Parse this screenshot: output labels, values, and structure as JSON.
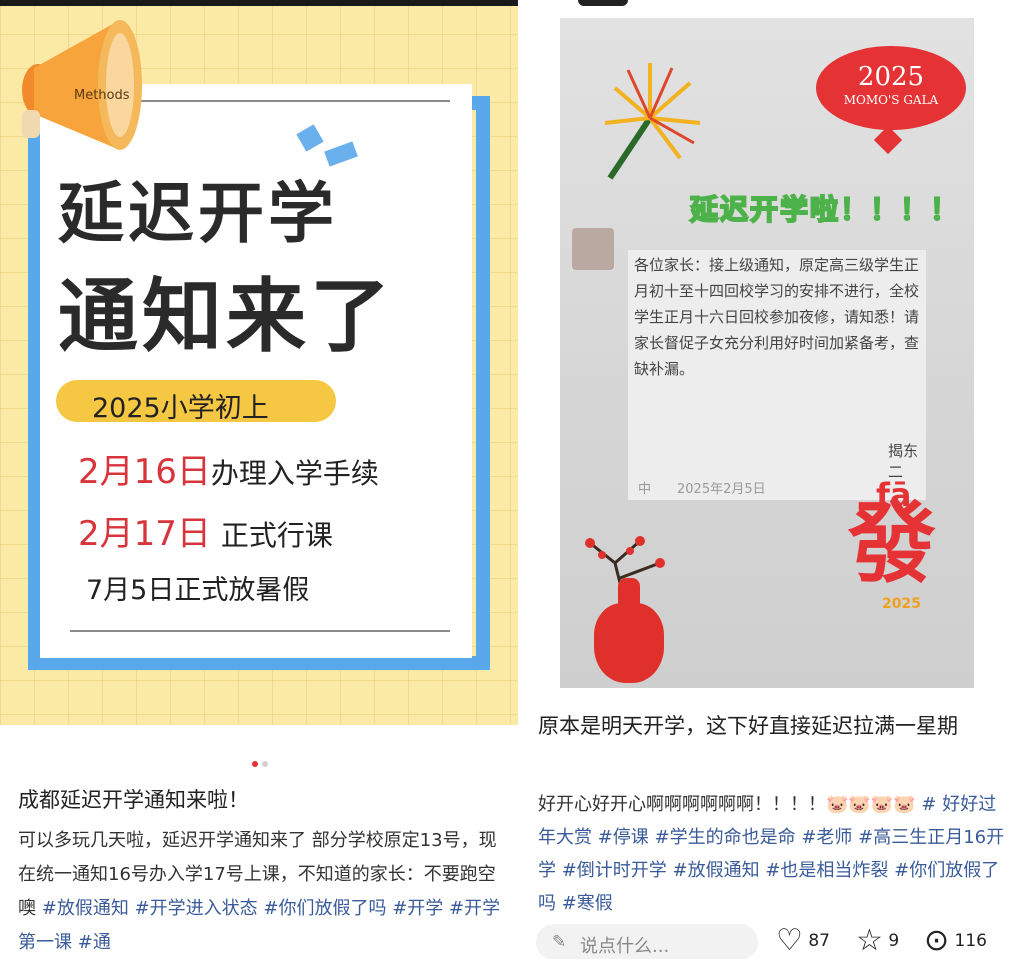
{
  "left_post": {
    "poster": {
      "megaphone_label": "Methods",
      "headline_line1": "延迟开学",
      "headline_line2": "通知来了",
      "pill_text": "2025小学初上",
      "date1": "2月16日",
      "date1_text": "办理入学手续",
      "date2": "2月17日",
      "date2_text": "正式行课",
      "line3": "7月5日正式放暑假"
    },
    "title": "成都延迟开学通知来啦！",
    "desc_plain": "可以多玩几天啦，延迟开学通知来了 部分学校原定13号，现在统一通知16号办入学17号上课，不知道的家长：不要跑空噢",
    "tags": [
      "#放假通知",
      "#开学进入状态",
      "#你们放假了吗",
      "#开学",
      "#开学第一课",
      "#通"
    ]
  },
  "right_post": {
    "photo": {
      "gala_year": "2025",
      "gala_name": "MOMO'S GALA",
      "banner": "延迟开学啦！！！！",
      "notice_text": "各位家长：接上级通知，原定高三级学生正月初十至十四回校学习的安排不进行，全校学生正月十六日回校参加夜修，请知悉！请家长督促子女充分利用好时间加紧备考，查缺补漏。",
      "signature": "揭东二",
      "date_line": "中　　2025年2月5日",
      "fa_pinyin": "fā",
      "fa_char": "發",
      "fa_year": "2025"
    },
    "caption": "原本是明天开学，这下好直接延迟拉满一星期",
    "text_prefix": "好开心好开心啊啊啊啊啊啊！！！！",
    "emoji": "🐷🐷🐷🐷",
    "tags_line": "# 好好过年大赏 #停课 #学生的命也是命 #老师 #高三生正月16开学 #倒计时开学 #放假通知 #也是相当炸裂 #你们放假了吗 #寒假",
    "comment_placeholder": "说点什么...",
    "likes": "87",
    "stars": "9",
    "comments": "116"
  },
  "colors": {
    "poster_yellow": "#fbe9a6",
    "poster_blue": "#59a8ec",
    "accent_red": "#d8343b",
    "tag_blue": "#3a5b9a",
    "dot_active": "#e53234"
  }
}
